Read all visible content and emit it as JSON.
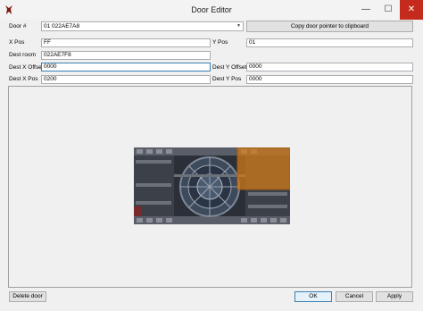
{
  "window": {
    "title": "Door Editor",
    "minimize": "—",
    "maximize": "☐",
    "close": "✕"
  },
  "door_select": {
    "label": "Door #",
    "value": "01 022AE7A8",
    "arrow": "▼"
  },
  "copy_button": "Copy door pointer to clipboard",
  "fields": {
    "x_pos": {
      "label": "X Pos",
      "value": "FF"
    },
    "y_pos": {
      "label": "Y Pos",
      "value": "01"
    },
    "dest_room": {
      "label": "Dest room",
      "value": "022AE7F8"
    },
    "dest_x_offset": {
      "label": "Dest X Offset",
      "value": "0000"
    },
    "dest_y_offset": {
      "label": "Dest Y Offset",
      "value": "0000"
    },
    "dest_x_pos": {
      "label": "Dest X Pos",
      "value": "0200"
    },
    "dest_y_pos": {
      "label": "Dest Y Pos",
      "value": "0000"
    }
  },
  "buttons": {
    "delete": "Delete door",
    "ok": "OK",
    "cancel": "Cancel",
    "apply": "Apply"
  },
  "colors": {
    "door_highlight": "#d07a1a",
    "close_button": "#c42b1c"
  }
}
